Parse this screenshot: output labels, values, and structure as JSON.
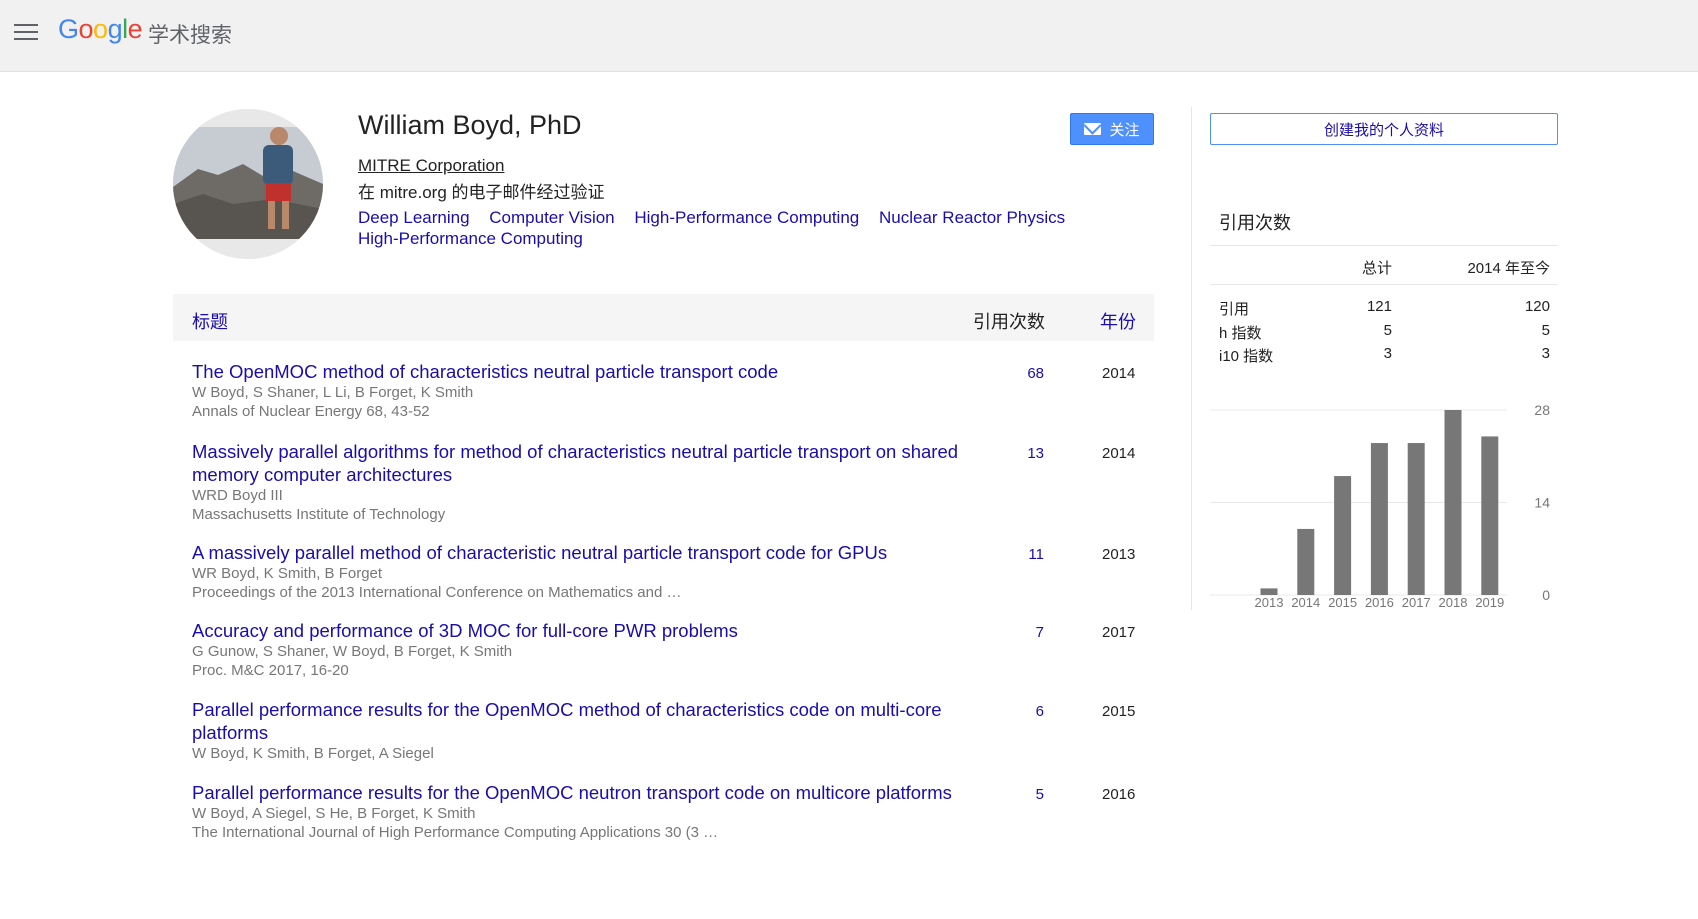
{
  "header": {
    "logo_text": "Google",
    "product": "学术搜索"
  },
  "profile": {
    "name": "William Boyd, PhD",
    "affiliation": "MITRE Corporation",
    "verified_email": "在 mitre.org 的电子邮件经过验证",
    "interests": [
      "Deep Learning",
      "Computer Vision",
      "High-Performance Computing",
      "Nuclear Reactor Physics",
      "High-Performance Computing"
    ],
    "follow_label": "关注"
  },
  "table": {
    "title_header": "标题",
    "cites_header": "引用次数",
    "year_header": "年份",
    "rows": [
      {
        "title": "The OpenMOC method of characteristics neutral particle transport code",
        "authors": "W Boyd, S Shaner, L Li, B Forget, K Smith",
        "venue": "Annals of Nuclear Energy 68, 43-52",
        "cites": "68",
        "year": "2014"
      },
      {
        "title": "Massively parallel algorithms for method of characteristics neutral particle transport on shared memory computer architectures",
        "authors": "WRD Boyd III",
        "venue": "Massachusetts Institute of Technology",
        "cites": "13",
        "year": "2014"
      },
      {
        "title": "A massively parallel method of characteristic neutral particle transport code for GPUs",
        "authors": "WR Boyd, K Smith, B Forget",
        "venue": "Proceedings of the 2013 International Conference on Mathematics and …",
        "cites": "11",
        "year": "2013"
      },
      {
        "title": "Accuracy and performance of 3D MOC for full-core PWR problems",
        "authors": "G Gunow, S Shaner, W Boyd, B Forget, K Smith",
        "venue": "Proc. M&C 2017, 16-20",
        "cites": "7",
        "year": "2017"
      },
      {
        "title": "Parallel performance results for the OpenMOC method of characteristics code on multi-core platforms",
        "authors": "W Boyd, K Smith, B Forget, A Siegel",
        "venue": "",
        "cites": "6",
        "year": "2015"
      },
      {
        "title": "Parallel performance results for the OpenMOC neutron transport code on multicore platforms",
        "authors": "W Boyd, A Siegel, S He, B Forget, K Smith",
        "venue": "The International Journal of High Performance Computing Applications 30 (3 …",
        "cites": "5",
        "year": "2016"
      }
    ]
  },
  "sidebar": {
    "create_profile_label": "创建我的个人资料",
    "cited_by_title": "引用次数",
    "col_all": "总计",
    "col_since": "2014 年至今",
    "stats": [
      {
        "label": "引用",
        "all": "121",
        "since": "120"
      },
      {
        "label": "h 指数",
        "all": "5",
        "since": "5"
      },
      {
        "label": "i10 指数",
        "all": "3",
        "since": "3"
      }
    ]
  },
  "chart_data": {
    "type": "bar",
    "categories": [
      "2013",
      "2014",
      "2015",
      "2016",
      "2017",
      "2018",
      "2019"
    ],
    "values": [
      1,
      10,
      18,
      23,
      23,
      28,
      24
    ],
    "yticks": [
      "28",
      "14",
      "0"
    ],
    "ylim": [
      0,
      28
    ],
    "bar_color": "#777777",
    "grid": true
  }
}
